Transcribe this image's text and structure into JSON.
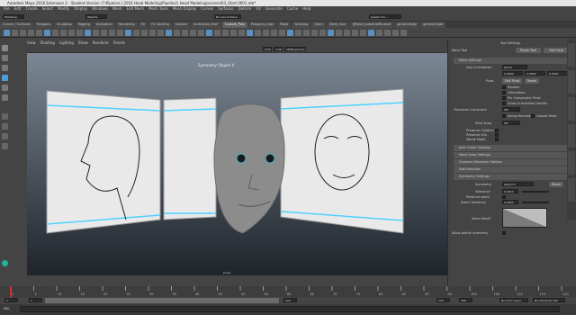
{
  "window": {
    "title": "Autodesk Maya 2016 Extension 2 - Student Version: F:\\Pipeline | 2016 Head Modeling\\Pipeline1 Head Modeling\\scenes\\03_Start.0001.mb*"
  },
  "menubar": [
    "File",
    "Edit",
    "Create",
    "Select",
    "Modify",
    "Display",
    "Windows",
    "Mesh",
    "Edit Mesh",
    "Mesh Tools",
    "Mesh Display",
    "Curves",
    "Surfaces",
    "Deform",
    "UV",
    "Generate",
    "Cache",
    "Help"
  ],
  "statusline": {
    "mode": "Modeling",
    "objects": "Objects",
    "live": "No Live Surface",
    "user": "Joseph Cro..."
  },
  "shelf": {
    "tabs": [
      "Curves / Surfaces",
      "Polygons",
      "Sculpting",
      "Rigging",
      "Animation",
      "Rendering",
      "FX",
      "FX Caching",
      "Custom",
      "Animation_Ever",
      "Custom_Poly",
      "Polygons_User",
      "Rtool",
      "Skinning",
      "Olam",
      "Olam_User",
      "@fixed_autoShelfSubset",
      "genericBody",
      "genericHead"
    ],
    "active": "Custom_Poly"
  },
  "panel": {
    "menu": [
      "View",
      "Shading",
      "Lighting",
      "Show",
      "Renderer",
      "Panels"
    ],
    "fields": [
      "0.00",
      "1.00",
      "sRGB gamma"
    ],
    "hud_title": "Symmetry: Object X",
    "hud_bottom": "persp"
  },
  "attr": {
    "title": "Tool Settings",
    "tool": "Move Tool",
    "reset_label": "Reset Tool",
    "help_label": "Tool Help",
    "move_settings": "Move Settings",
    "axis_label": "Axis Orientation",
    "axis_value": "World",
    "coords": [
      "0.0000",
      "0.0000",
      "0.0000"
    ],
    "pivot_label": "Pivot",
    "edit_pivot": "Edit Pivot",
    "reset_pivot": "Reset",
    "pivot_opts": [
      "Position",
      "Orientation",
      "Pin Component Pivot",
      "Show Orientation Handle"
    ],
    "transform_label": "Transform Constraint",
    "transform_value": "Off",
    "along_normals": "Along Normals",
    "closest_point": "Closest Point",
    "step_snap": "Step Snap",
    "step_value": "Off",
    "preserve": [
      "Preserve Children",
      "Preserve UVs",
      "Tweak Mode"
    ],
    "sections": [
      "Joint Orient Settings",
      "Move Snap Settings",
      "Common Selection Options",
      "Soft Selection",
      "Symmetry Settings"
    ],
    "symmetry_label": "Symmetry",
    "symmetry_value": "Object X",
    "sym_reset": "Reset",
    "tolerance_label": "Tolerance",
    "tolerance_value": "0.0010",
    "preserve_seam": "Preserve seam",
    "seam_tol_label": "Seam Tolerance",
    "seam_tol_value": "0.0500",
    "seam_falloff": "Seam falloff",
    "allow_partial": "Allow partial symmetry"
  },
  "timeline": {
    "ticks": [
      "1",
      "5",
      "10",
      "15",
      "20",
      "25",
      "30",
      "35",
      "40",
      "45",
      "50",
      "55",
      "60",
      "65",
      "70",
      "75",
      "80",
      "85",
      "90",
      "95",
      "100",
      "105",
      "110",
      "115",
      "120"
    ],
    "current": "1",
    "start": "1",
    "end": "120",
    "range_start": "1",
    "range_end": "120",
    "max_end": "200",
    "anim_layer": "No Anim Layer",
    "char_set": "No Character Set"
  },
  "cmdline": {
    "lang": "MEL"
  },
  "colors": {
    "accent": "#4dd1ff",
    "panel": "#444444",
    "viewport_top": "#7b8794",
    "viewport_bottom": "#1f242a",
    "face": "#8a8a8a"
  }
}
